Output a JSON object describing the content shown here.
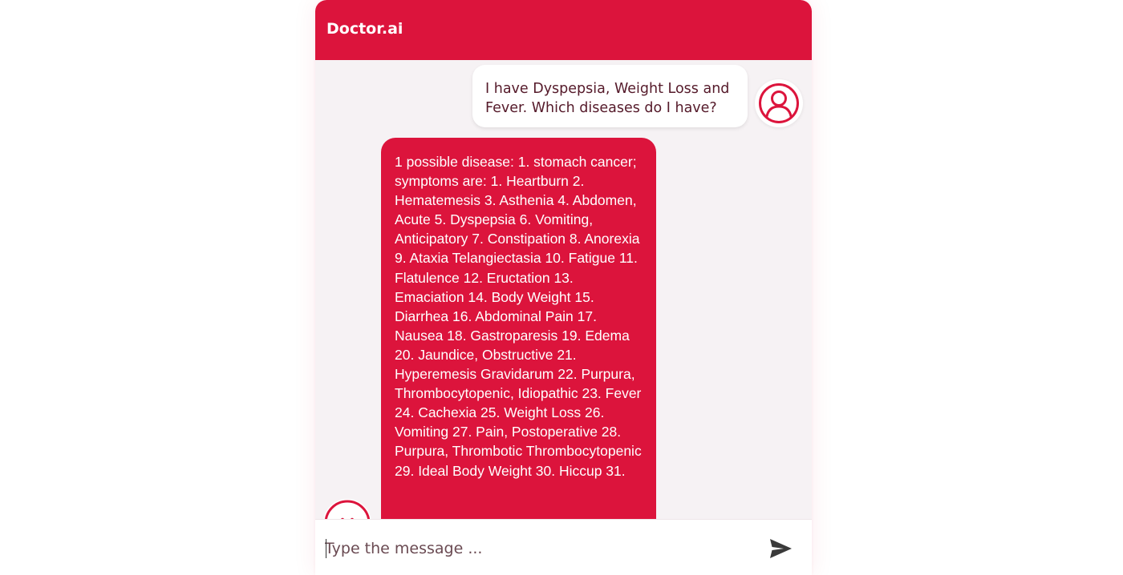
{
  "app": {
    "title": "Doctor.ai",
    "accent_color": "#dc143c"
  },
  "messages": [
    {
      "role": "user",
      "avatar_icon": "user-circle-icon",
      "text": "I have Dyspepsia, Weight Loss and Fever. Which diseases do I have?"
    },
    {
      "role": "bot",
      "avatar_icon": "bot-avatar-icon",
      "text": "1 possible disease: 1. stomach cancer; symptoms are: 1. Heartburn 2. Hematemesis 3. Asthenia 4. Abdomen, Acute 5. Dyspepsia 6. Vomiting, Anticipatory 7. Constipation 8. Anorexia 9. Ataxia Telangiectasia 10. Fatigue 11. Flatulence 12. Eructation 13. Emaciation 14. Body Weight 15. Diarrhea 16. Abdominal Pain 17. Nausea 18. Gastroparesis 19. Edema 20. Jaundice, Obstructive 21. Hyperemesis Gravidarum 22. Purpura, Thrombocytopenic, Idiopathic 23. Fever 24. Cachexia 25. Weight Loss 26. Vomiting 27. Pain, Postoperative 28. Purpura, Thrombotic Thrombocytopenic 29. Ideal Body Weight 30. Hiccup 31."
    }
  ],
  "composer": {
    "placeholder": "Type the message ...",
    "value": "",
    "send_icon": "send-icon"
  }
}
